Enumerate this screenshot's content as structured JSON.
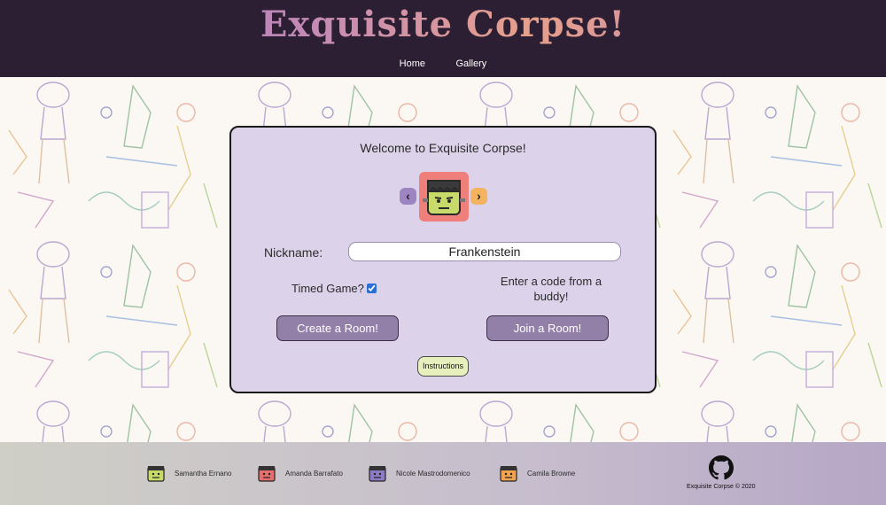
{
  "header": {
    "title": "Exquisite Corpse!",
    "nav": [
      {
        "label": "Home"
      },
      {
        "label": "Gallery"
      }
    ]
  },
  "card": {
    "welcome": "Welcome to Exquisite Corpse!",
    "avatar": {
      "icon": "frankenstein-face-icon",
      "bg_color": "#ee7f7b"
    },
    "prev_arrow": "‹",
    "next_arrow": "›",
    "nickname_label": "Nickname:",
    "nickname_value": "Frankenstein",
    "timed_label": "Timed Game?",
    "timed_checked": true,
    "code_prompt": "Enter a code from a buddy!",
    "create_label": "Create a Room!",
    "join_label": "Join a Room!",
    "instructions_label": "Instructions"
  },
  "footer": {
    "members": [
      {
        "name": "Samantha Ernano",
        "face_color": "#c8db6a"
      },
      {
        "name": "Amanda Barrafato",
        "face_color": "#e56e6e"
      },
      {
        "name": "Nicole Mastrodomenico",
        "face_color": "#8c7bc4"
      },
      {
        "name": "Camila Browne",
        "face_color": "#f0a24e"
      }
    ],
    "github_icon": "github-icon",
    "copyright": "Exquisite Corpse © 2020"
  }
}
